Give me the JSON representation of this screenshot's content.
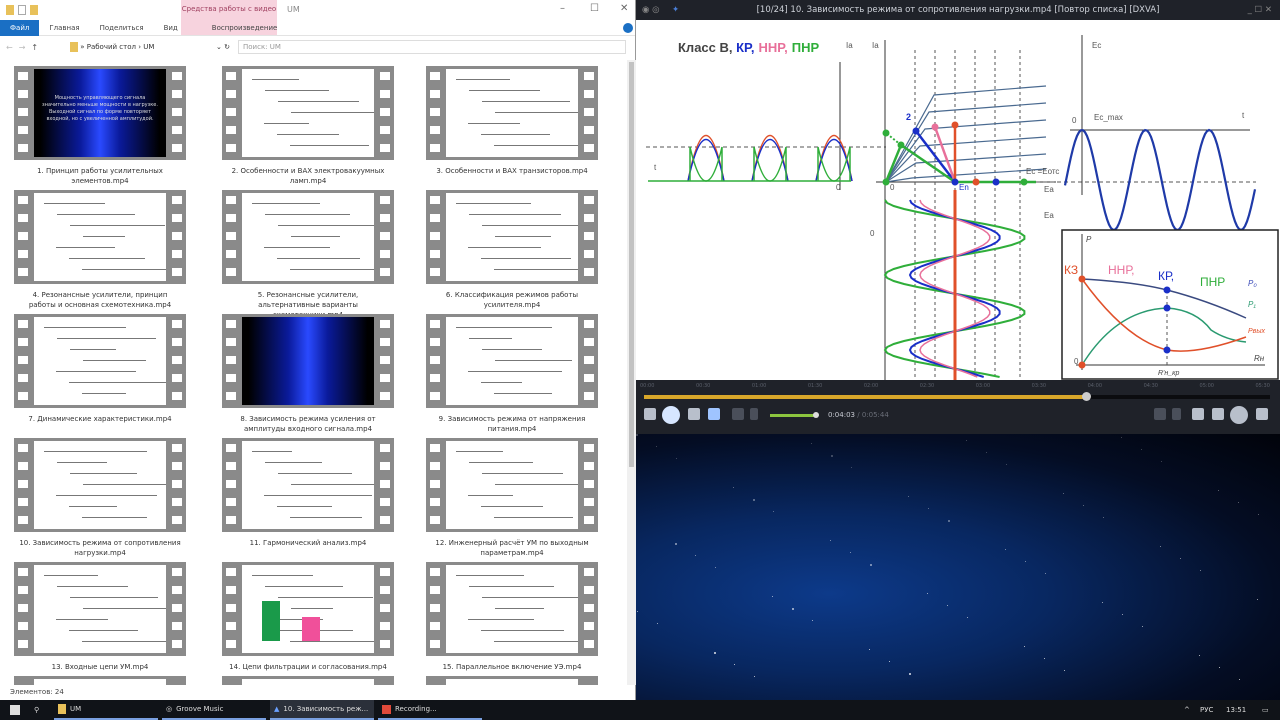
{
  "explorer": {
    "title": "UM",
    "context_tab": "Средства работы с видео",
    "tabs": [
      "Файл",
      "Главная",
      "Поделиться",
      "Вид",
      "Воспроизведение"
    ],
    "breadcrumb": [
      "Рабочий стол",
      "UM"
    ],
    "search_placeholder": "Поиск: UM",
    "status": "Элементов: 24",
    "items": [
      {
        "label": "1. Принцип работы усилительных элементов.mp4",
        "thumb": "blue-text",
        "thumb_text": "Мощность управляющего сигнала значительно меньше мощности в нагрузке. Выходной сигнал по форме повторяет входной, но с увеличенной амплитудой."
      },
      {
        "label": "2. Особенности и ВАХ электровакуумных ламп.mp4",
        "thumb": "diagram"
      },
      {
        "label": "3. Особенности и ВАХ транзисторов.mp4",
        "thumb": "diagram"
      },
      {
        "label": "4. Резонансные усилители, принцип работы и основная схемотехника.mp4",
        "thumb": "diagram"
      },
      {
        "label": "5. Резонансные усилители, альтернативные варианты схемотехники.mp4",
        "thumb": "diagram"
      },
      {
        "label": "6. Классификация режимов работы усилителя.mp4",
        "thumb": "table"
      },
      {
        "label": "7. Динамические характеристики.mp4",
        "thumb": "chart"
      },
      {
        "label": "8. Зависимость режима усиления от амплитуды входного сигнала.mp4",
        "thumb": "blue"
      },
      {
        "label": "9. Зависимость режима от напряжения питания.mp4",
        "thumb": "chart"
      },
      {
        "label": "10. Зависимость режима от сопротивления нагрузки.mp4",
        "thumb": "chart"
      },
      {
        "label": "11. Гармонический анализ.mp4",
        "thumb": "chart"
      },
      {
        "label": "12. Инженерный расчёт УМ по выходным параметрам.mp4",
        "thumb": "text"
      },
      {
        "label": "13. Входные цепи УМ.mp4",
        "thumb": "diagram"
      },
      {
        "label": "14. Цепи фильтрации и согласования.mp4",
        "thumb": "bars"
      },
      {
        "label": "15. Параллельное включение УЭ.mp4",
        "thumb": "text"
      }
    ]
  },
  "player": {
    "title": "[10/24] 10. Зависимость режима от сопротивления нагрузки.mp4 [Повтор списка] [DXVA]",
    "elapsed": "0:04:03",
    "total": "/ 0:05:44",
    "progress_fraction": 0.706,
    "volume_fraction": 1.0,
    "timeline_labels": [
      "00:00",
      "00:30",
      "01:00",
      "01:30",
      "02:00",
      "02:30",
      "03:00",
      "03:30",
      "04:00",
      "04:30",
      "05:00",
      "05:30"
    ],
    "accent": "#d8a72a"
  },
  "slide": {
    "title_prefix": "Класс В, ",
    "kr": "КР,",
    "nnr": "ННР,",
    "pnr": "ПНР",
    "ia": "Ia",
    "t": "t",
    "zero": "0",
    "ea": "Ea",
    "en": "En",
    "ec_eotc": "Ec =Eотс",
    "two": "2",
    "ec": "Ec",
    "ec_max": "Ec_max",
    "p": "P",
    "kz": "КЗ",
    "p0": "P₀",
    "p1": "P₁",
    "pout": "Pвых",
    "rn": "Rн",
    "rn_kr": "R'н_кр",
    "colors": {
      "kr": "#1a2fc8",
      "nnr": "#e8709a",
      "pnr": "#2fae3a",
      "red": "#e0502a",
      "grid": "#4a6a90"
    }
  },
  "taskbar": {
    "items": [
      "UM",
      "Groove Music",
      "10. Зависимость реж...",
      "Recording..."
    ],
    "lang": "РУС",
    "clock": "13:51"
  }
}
